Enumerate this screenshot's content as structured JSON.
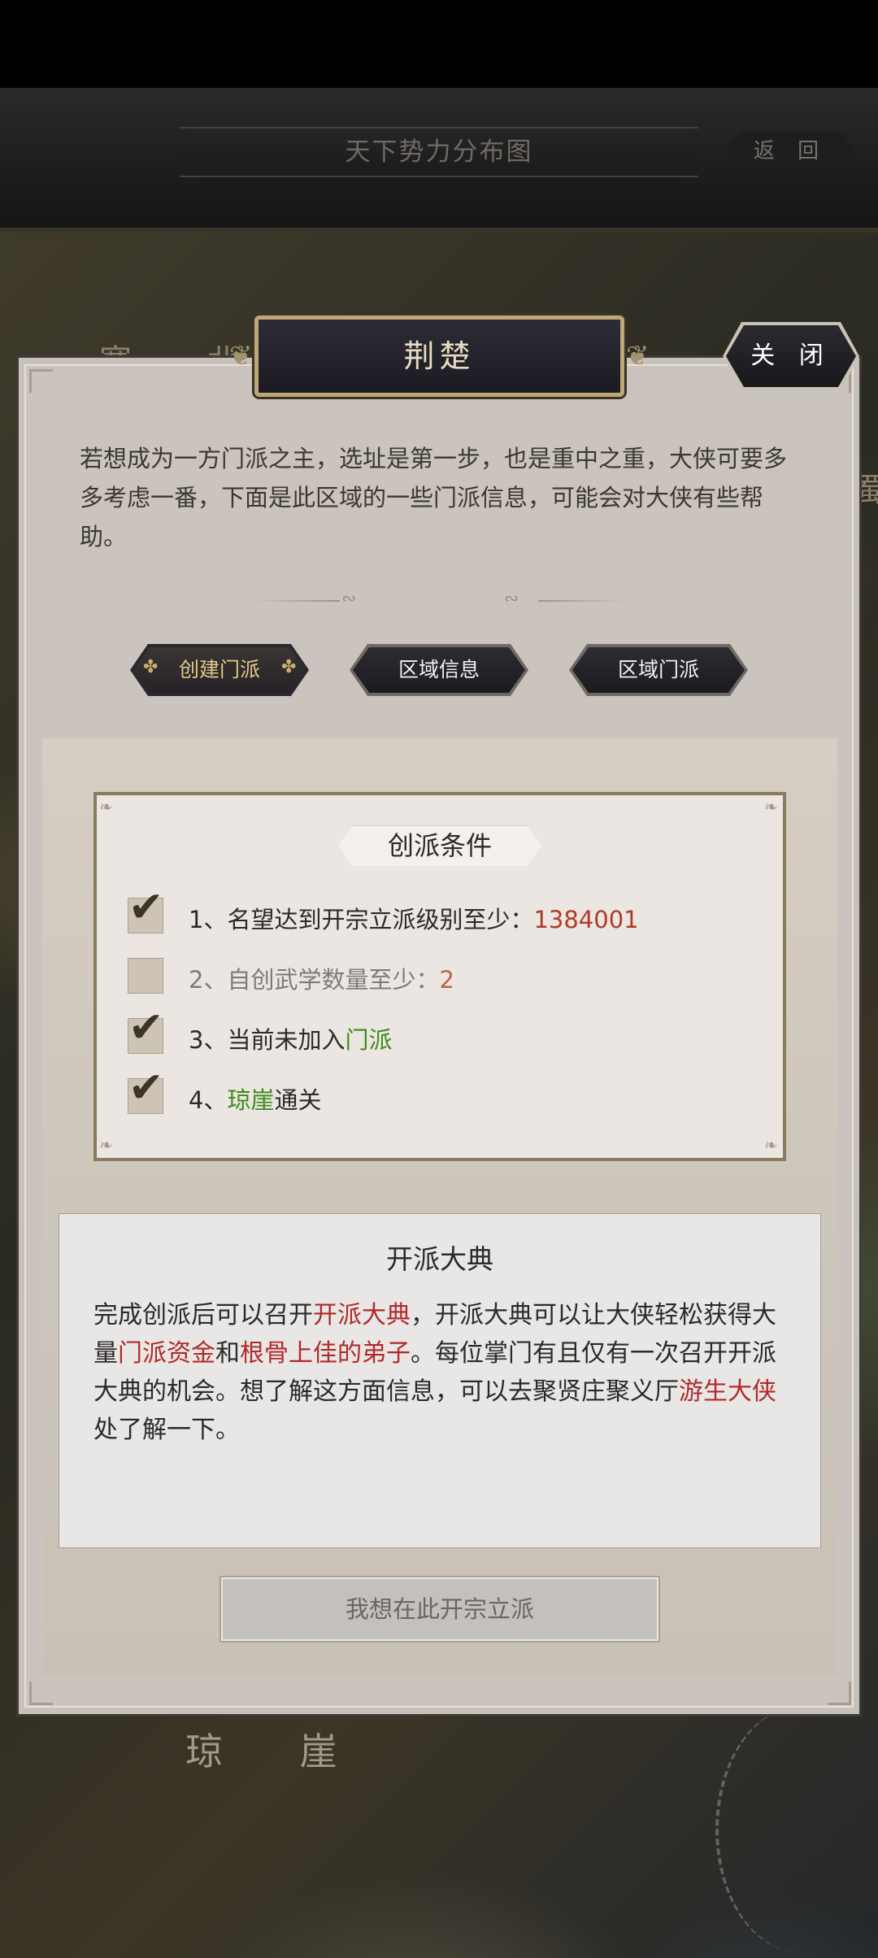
{
  "header": {
    "title": "天下势力分布图",
    "back_label": "返 回"
  },
  "map": {
    "label_north": "塞 北",
    "label_qiongya": "琼 崖",
    "label_right": "蜀"
  },
  "dialog": {
    "region_name": "荆楚",
    "close_label": "关 闭",
    "intro_text": "若想成为一方门派之主，选址是第一步，也是重中之重，大侠可要多多考虑一番，下面是此区域的一些门派信息，可能会对大侠有些帮助。",
    "tabs": [
      {
        "label": "创建门派",
        "active": true
      },
      {
        "label": "区域信息",
        "active": false
      },
      {
        "label": "区域门派",
        "active": false
      }
    ],
    "conditions": {
      "title": "创派条件",
      "items": [
        {
          "prefix": "1、名望达到开宗立派级别至少：",
          "value": "1384001",
          "suffix": "",
          "checked": true
        },
        {
          "prefix": "2、自创武学数量至少：",
          "value": "2",
          "suffix": "",
          "checked": false
        },
        {
          "prefix": "3、当前未加入",
          "value": "门派",
          "suffix": "",
          "checked": true
        },
        {
          "prefix": "4、",
          "value": "琼崖",
          "suffix": "通关",
          "checked": true
        }
      ]
    },
    "ceremony": {
      "title": "开派大典",
      "parts": [
        "完成创派后可以召开",
        "开派大典",
        "，开派大典可以让大侠轻松获得大量",
        "门派资金",
        "和",
        "根骨上佳的弟子",
        "。每位掌门有且仅有一次召开开派大典的机会。想了解这方面信息，可以去聚贤庄聚义厅",
        "游生大侠",
        "处了解一下。"
      ]
    },
    "found_button_label": "我想在此开宗立派"
  },
  "colors": {
    "highlight_red": "#b03a2a",
    "highlight_green": "#3c8a1c",
    "active_tab_text": "#e2c98a"
  }
}
